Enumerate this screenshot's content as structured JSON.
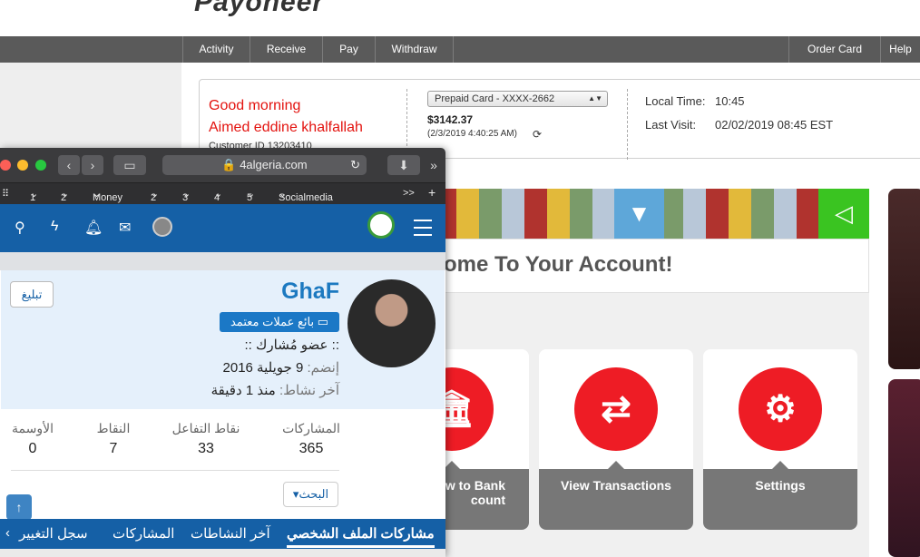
{
  "payoneer": {
    "logo": "Payoneer",
    "nav": {
      "activity": "Activity",
      "receive": "Receive",
      "pay": "Pay",
      "withdraw": "Withdraw",
      "order_card": "Order Card",
      "help": "Help"
    },
    "greeting": "Good morning",
    "user_name": "Aimed eddine khalfallah",
    "customer_id": "Customer ID 13203410",
    "card_select": "Prepaid Card - XXXX-2662",
    "balance": "$3142.37",
    "balance_date": "(2/3/2019 4:40:25 AM)",
    "local_time_label": "Local Time:",
    "local_time": "10:45",
    "last_visit_label": "Last Visit:",
    "last_visit": "02/02/2019 08:45 EST",
    "welcome": "ome To Your Account!",
    "tiles": {
      "bank": "w to Bank\ncount",
      "transactions": "View Transactions",
      "settings": "Settings"
    },
    "colors": {
      "accent_red": "#ee1c25",
      "nav_gray": "#5a5a5a"
    }
  },
  "browser": {
    "url": "4algeria.com",
    "bookmarks": [
      "1",
      "2",
      "Money",
      "2",
      "3",
      "4",
      "5",
      "Socialmedia"
    ],
    "more": ">>"
  },
  "forum": {
    "username": "GhaF",
    "report_button": "تبليغ",
    "badge": "بائع عملات معتمد",
    "rank": ":: عضو مُشارك ::",
    "joined_label": "إنضم:",
    "joined_value": "9 جويلية 2016",
    "last_activity_label": "آخر نشاط:",
    "last_activity_value": "منذ 1 دقيقة",
    "stats": {
      "posts_label": "المشاركات",
      "posts": "365",
      "reactions_label": "نقاط التفاعل",
      "reactions": "33",
      "points_label": "النقاط",
      "points": "7",
      "medals_label": "الأوسمة",
      "medals": "0"
    },
    "search_button": "البحث",
    "tabs": {
      "profile_posts": "مشاركات الملف الشخصي",
      "latest_activity": "آخر النشاطات",
      "posts": "المشاركات",
      "change_log": "سجل التغيير"
    },
    "colors": {
      "header_blue": "#1560a6",
      "profile_bg": "#e5f0fb"
    }
  }
}
